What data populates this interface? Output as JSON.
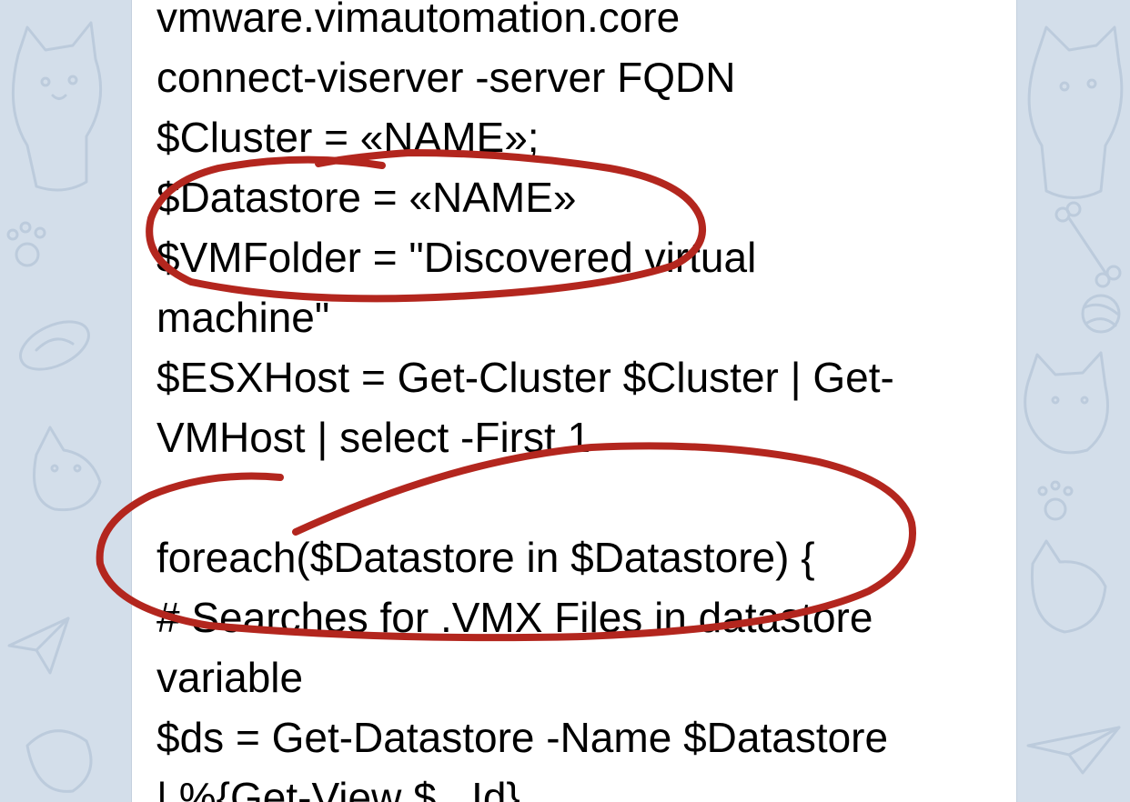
{
  "message": {
    "lines": [
      "vmware.vimautomation.core",
      "connect-viserver -server FQDN",
      "$Cluster = «NAME»;",
      "$Datastore = «NAME»",
      "$VMFolder = \"Discovered virtual",
      "machine\"",
      "$ESXHost = Get-Cluster $Cluster | Get-",
      "VMHost | select -First 1",
      "",
      "foreach($Datastore in $Datastore) {",
      "# Searches for .VMX Files in datastore",
      "variable",
      "$ds = Get-Datastore -Name $Datastore",
      "| %{Get-View $_.Id}"
    ]
  },
  "annotations": {
    "stroke_color": "#b3261e"
  },
  "colors": {
    "wallpaper": "#d3deea",
    "wallpaper_doodles": "#bccbdc",
    "bubble": "#ffffff",
    "text": "#000000"
  },
  "icons": [
    "cat-doodle-icon",
    "paw-icon",
    "bone-icon",
    "yarn-ball-icon",
    "paper-plane-icon",
    "fish-bowl-icon"
  ]
}
